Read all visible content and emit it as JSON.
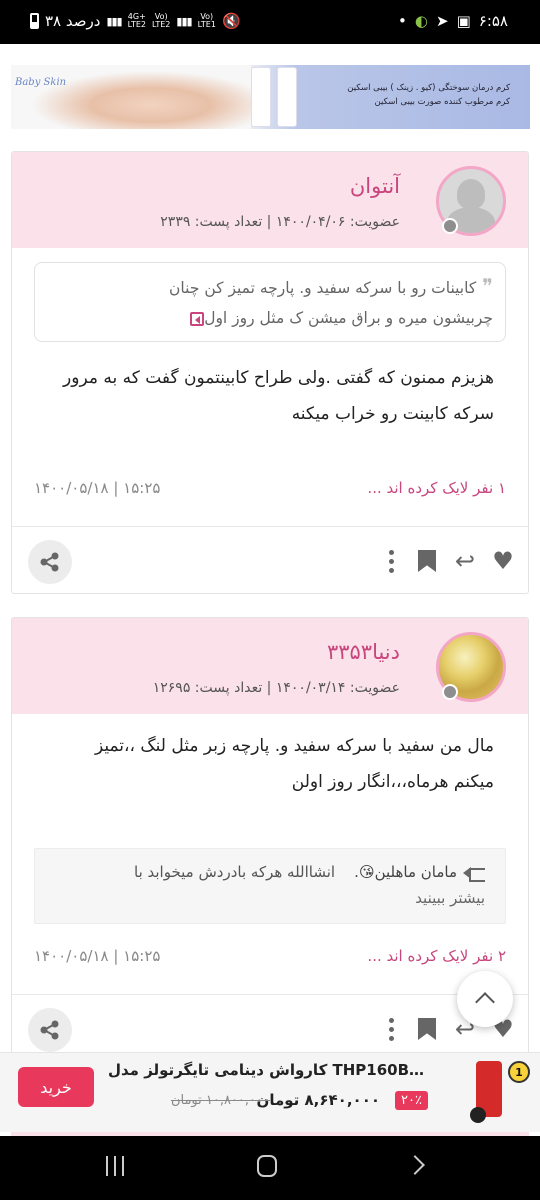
{
  "status_bar": {
    "time": "۶:۵۸",
    "battery_text": "۳۸ درصد",
    "net1": "4G+\nLTE2",
    "net2": "Vo)\nLTE2",
    "net3": "Vo)\nLTE1"
  },
  "banner_ad": {
    "logo_text": "Baby Skin",
    "line1": "کرم درمان سوختگی (کیو . زینک ) بیبی اسکین",
    "line2": "کرم مرطوب کننده صورت بیبی اسکین"
  },
  "posts": [
    {
      "username": "آنتوان",
      "meta": "عضویت: ۱۴۰۰/۰۴/۰۶ | تعداد پست: ۲۳۳۹",
      "quote_line1": "کابینات رو با سرکه سفید و. پارچه تمیز کن چنان",
      "quote_line2": "چربیشون میره و براق میشن ک مثل روز اول",
      "body_line1": "هزیزم ممنون که گفتی .ولی طراح کابینتمون گفت که به مرور",
      "body_line2": "سرکه کابینت رو خراب میکنه",
      "likes": "۱ نفر لایک کرده اند ...",
      "date": "۱۴۰۰/۰۵/۱۸ | ۱۵:۲۵"
    },
    {
      "username": "دنیا۳۳۵۳",
      "meta": "عضویت: ۱۴۰۰/۰۳/۱۴ | تعداد پست: ۱۲۶۹۵",
      "body_line1": "مال من سفید با سرکه سفید و. پارچه زبر مثل لنگ ،،تمیز",
      "body_line2": "میکنم هرماه،،،انگار روز اولن",
      "reply_author": "مامان ماهلین😘.",
      "reply_text": "انشاالله هرکه بادردش میخوابد با",
      "reply_more": "بیشتر ببینید",
      "likes": "۲ نفر لایک کرده اند ...",
      "date": "۱۴۰۰/۰۵/۱۸ | ۱۵:۲۵"
    }
  ],
  "product_ad": {
    "rank_badge": "1",
    "title": "کارواش دینامی تایگرتولز مدل THP160B-180...",
    "discount": "۲۰٪",
    "price": "۸,۶۴۰,۰۰۰ تومان",
    "old_price": "۱۰,۸۰۰,۰۰۰ تومان",
    "buy_label": "خرید"
  },
  "colors": {
    "accent": "#c8467d",
    "header_bg": "#fae1ea",
    "buy_button": "#e8395d"
  },
  "icons": [
    "share-icon",
    "more-vert-icon",
    "bookmark-icon",
    "reply-icon",
    "heart-icon",
    "chevron-up-icon"
  ]
}
